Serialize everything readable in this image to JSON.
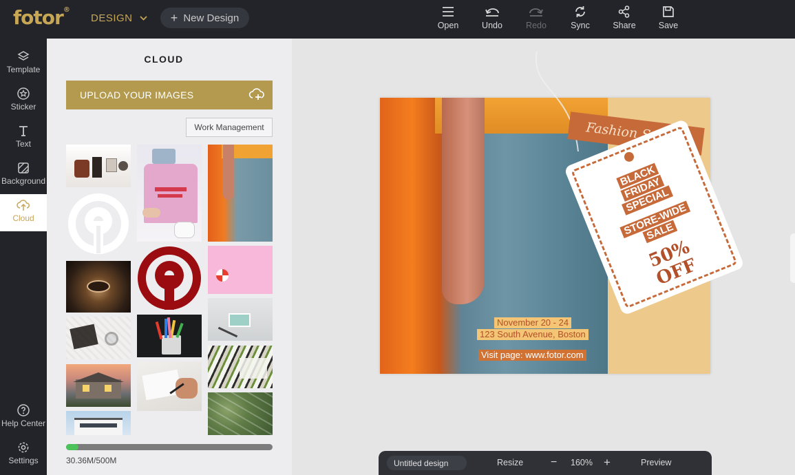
{
  "brand": {
    "logo_text": "fotor",
    "registered_mark": "®",
    "accent": "#c7a655"
  },
  "header": {
    "design_menu_label": "DESIGN",
    "new_design_label": "New Design",
    "actions": [
      {
        "label": "Open",
        "icon": "menu-icon",
        "enabled": true
      },
      {
        "label": "Undo",
        "icon": "undo-icon",
        "enabled": true
      },
      {
        "label": "Redo",
        "icon": "redo-icon",
        "enabled": false
      },
      {
        "label": "Sync",
        "icon": "sync-icon",
        "enabled": true
      },
      {
        "label": "Share",
        "icon": "share-icon",
        "enabled": true
      },
      {
        "label": "Save",
        "icon": "save-icon",
        "enabled": true
      }
    ]
  },
  "sidebar": {
    "items": [
      {
        "label": "Template",
        "icon": "layers-icon"
      },
      {
        "label": "Sticker",
        "icon": "star-icon"
      },
      {
        "label": "Text",
        "icon": "text-icon"
      },
      {
        "label": "Background",
        "icon": "background-icon"
      },
      {
        "label": "Cloud",
        "icon": "cloud-upload-icon",
        "active": true
      }
    ],
    "bottom_items": [
      {
        "label": "Help Center",
        "icon": "help-icon"
      },
      {
        "label": "Settings",
        "icon": "gear-icon"
      }
    ]
  },
  "panel": {
    "title": "CLOUD",
    "upload_label": "UPLOAD YOUR IMAGES",
    "work_management_label": "Work Management",
    "images": [
      "boots-flatlay-thumb",
      "pink-tshirt-thumb",
      "jeans-pocket-thumb",
      "white-pin-logo-thumb",
      "pink-lollipop-thumb",
      "eye-closeup-thumb",
      "red-pin-logo-thumb",
      "hello-card-thumb",
      "bed-flatlay-thumb",
      "pens-cup-thumb",
      "newspaper-collage-thumb",
      "house-exterior-thumb",
      "hand-writing-thumb",
      "aerial-town-thumb",
      "modern-building-thumb"
    ],
    "storage": {
      "used": "30.36M",
      "total": "500M",
      "text": "30.36M/500M",
      "fraction_used": 0.0607
    }
  },
  "canvas": {
    "banner_text": "Fashion Spring",
    "tag_lines": [
      "BLACK",
      "FRIDAY",
      "SPECIAL"
    ],
    "tag_lines2": [
      "STORE-WIDE",
      "SALE"
    ],
    "tag_discount": [
      "50%",
      "OFF"
    ],
    "dates": "November 20 - 24",
    "address": "123 South Avenue, Boston",
    "visit": "Visit page: www.fotor.com"
  },
  "bottom_bar": {
    "doc_name": "Untitled design",
    "resize_label": "Resize",
    "zoom_out": "−",
    "zoom_level": "160%",
    "zoom_in": "+",
    "preview_label": "Preview"
  }
}
